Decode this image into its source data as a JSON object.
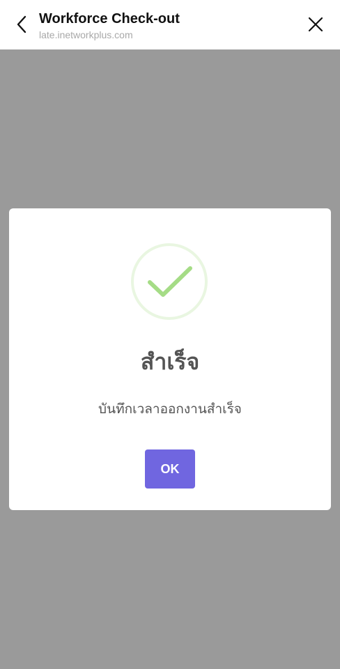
{
  "header": {
    "title": "Workforce Check-out",
    "url": "late.inetworkplus.com",
    "back_icon": "chevron-left-icon",
    "close_icon": "close-icon"
  },
  "overlay": {
    "backdrop_color": "#9a9a9a"
  },
  "modal": {
    "icon": "checkmark-icon",
    "icon_color": "#a5dc86",
    "title": "สำเร็จ",
    "message": "บันทึกเวลาออกงานสำเร็จ",
    "ok_label": "OK",
    "ok_color": "#7066e0"
  }
}
